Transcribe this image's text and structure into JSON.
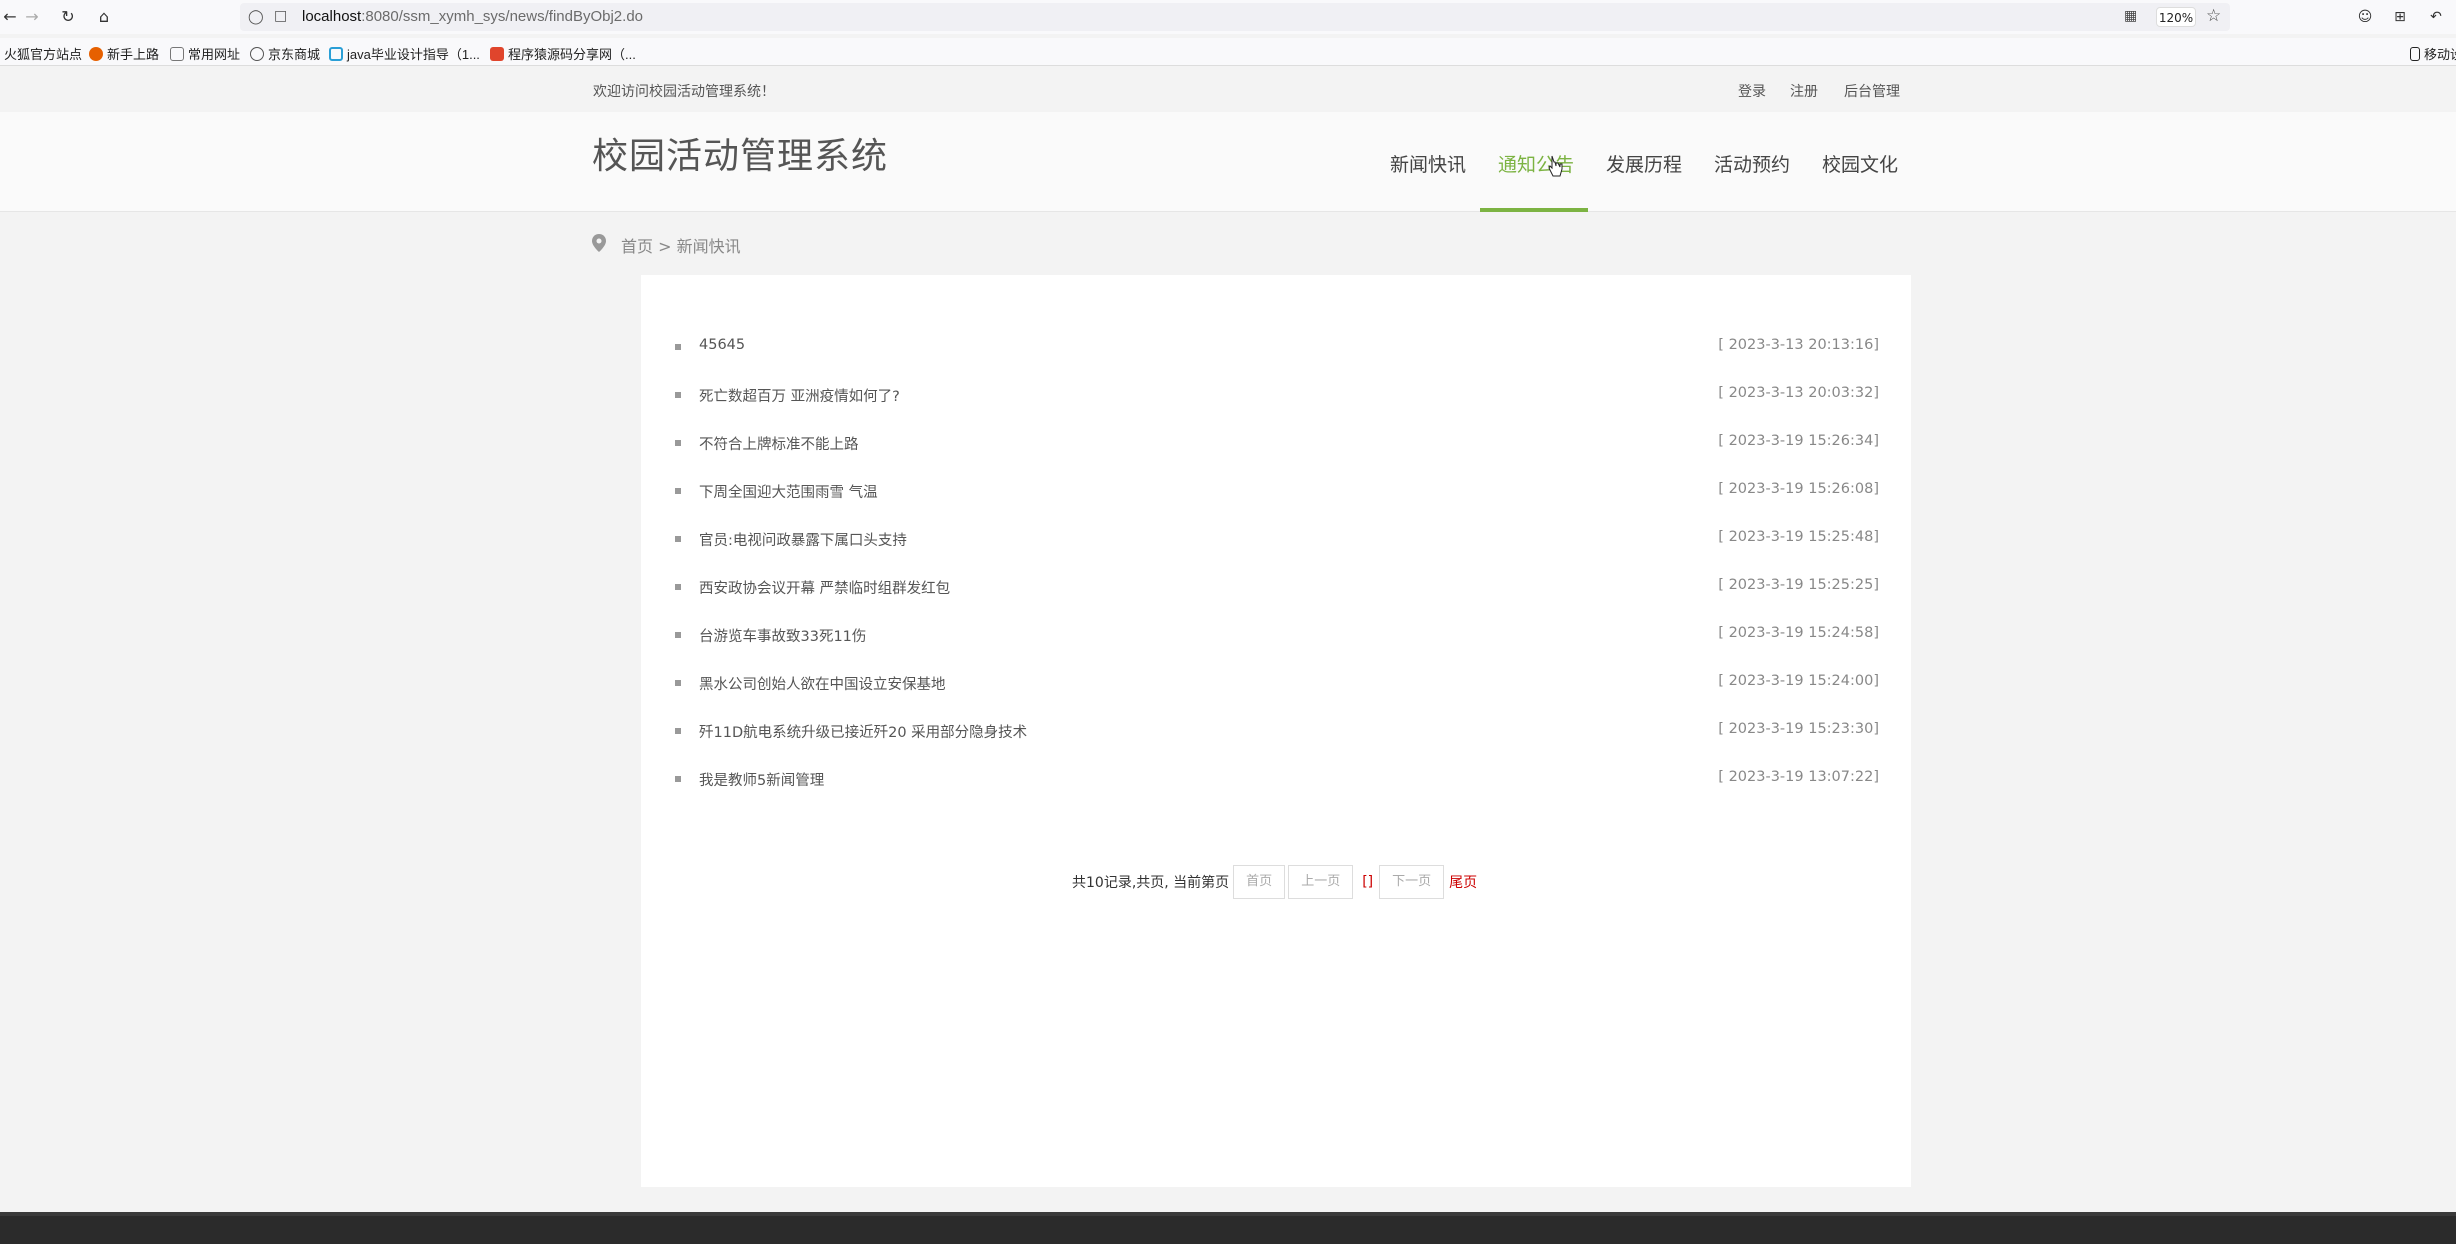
{
  "browser": {
    "url_host": "localhost",
    "url_path": ":8080/ssm_xymh_sys/news/findByObj2.do",
    "zoom": "120%",
    "bookmarks": [
      {
        "label": "火狐官方站点",
        "color": "#e66000"
      },
      {
        "label": "新手上路",
        "color": "#e66000"
      },
      {
        "label": "常用网址",
        "color": "#777"
      },
      {
        "label": "京东商城",
        "color": "#555"
      },
      {
        "label": "java毕业设计指导（1...",
        "color": "#2a9fd6"
      },
      {
        "label": "程序猿源码分享网（...",
        "color": "#e0452c"
      }
    ],
    "mobile_label": "移动设"
  },
  "topbar": {
    "welcome": "欢迎访问校园活动管理系统！",
    "login": "登录",
    "register": "注册",
    "admin": "后台管理"
  },
  "header": {
    "logo": "校园活动管理系统",
    "nav": [
      "新闻快讯",
      "通知公告",
      "发展历程",
      "活动预约",
      "校园文化"
    ],
    "active_index": 1
  },
  "breadcrumb": {
    "home": "首页",
    "sep": " > ",
    "current": "新闻快讯"
  },
  "news": [
    {
      "title": "45645",
      "date": "[ 2023-3-13 20:13:16]"
    },
    {
      "title": "死亡数超百万 亚洲疫情如何了?",
      "date": "[ 2023-3-13 20:03:32]"
    },
    {
      "title": "不符合上牌标准不能上路",
      "date": "[ 2023-3-19 15:26:34]"
    },
    {
      "title": "下周全国迎大范围雨雪 气温",
      "date": "[ 2023-3-19 15:26:08]"
    },
    {
      "title": "官员:电视问政暴露下属口头支持",
      "date": "[ 2023-3-19 15:25:48]"
    },
    {
      "title": "西安政协会议开幕 严禁临时组群发红包",
      "date": "[ 2023-3-19 15:25:25]"
    },
    {
      "title": "台游览车事故致33死11伤",
      "date": "[ 2023-3-19 15:24:58]"
    },
    {
      "title": "黑水公司创始人欲在中国设立安保基地",
      "date": "[ 2023-3-19 15:24:00]"
    },
    {
      "title": "歼11D航电系统升级已接近歼20 采用部分隐身技术",
      "date": "[ 2023-3-19 15:23:30]"
    },
    {
      "title": "我是教师5新闻管理",
      "date": "[ 2023-3-19 13:07:22]"
    }
  ],
  "pager": {
    "info": "共10记录,共页, 当前第页",
    "first": "首页",
    "prev": "上一页",
    "current": "[]",
    "next": "下一页",
    "last": "尾页"
  }
}
